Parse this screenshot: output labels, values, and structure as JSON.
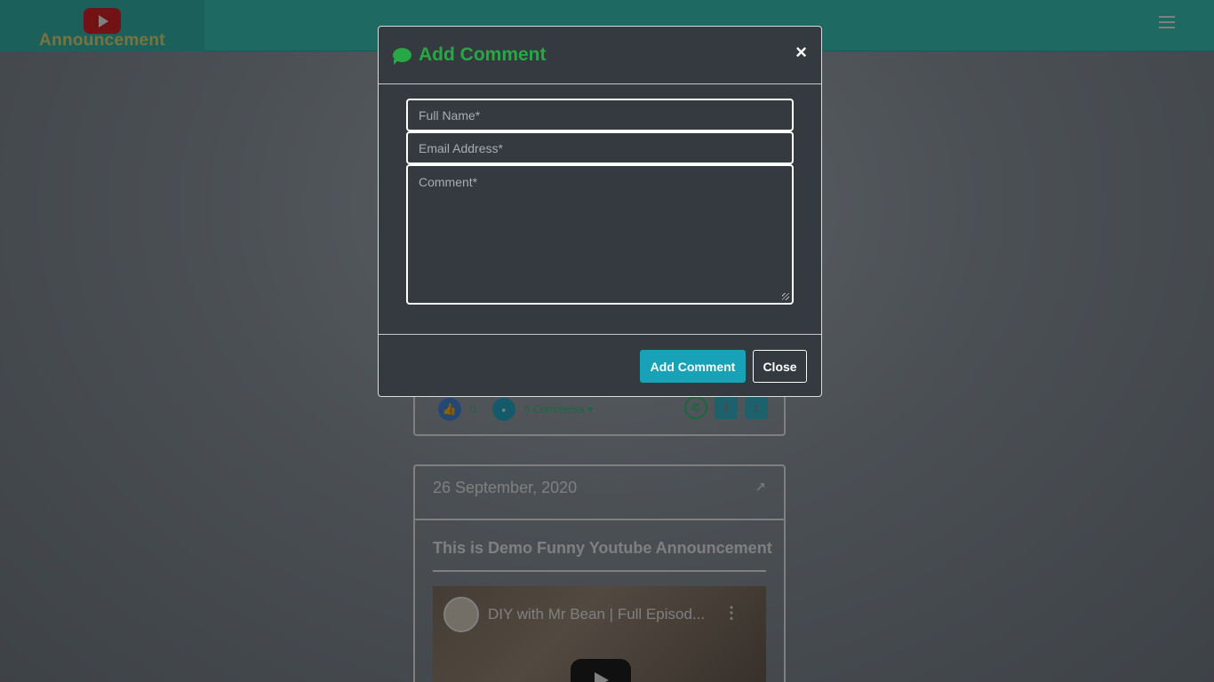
{
  "nav": {
    "brand_text": "Announcement",
    "menu_icon": "hamburger-icon"
  },
  "card1": {
    "like_count": "0",
    "comments_label": "0 Comments",
    "share_icons": [
      "whatsapp-icon",
      "facebook-icon",
      "twitter-icon"
    ]
  },
  "card2": {
    "date": "26 September, 2020",
    "title": "This is Demo Funny Youtube Announcement",
    "video_title": "DIY with Mr Bean | Full Episod..."
  },
  "modal": {
    "title": "Add Comment",
    "close_symbol": "×",
    "fullname_placeholder": "Full Name*",
    "email_placeholder": "Email Address*",
    "comment_placeholder": "Comment*",
    "add_button": "Add Comment",
    "close_button": "Close"
  },
  "colors": {
    "accent": "#3fd3c6",
    "title_green": "#28a745",
    "add_button": "#17a2b8",
    "modal_bg": "#343a40"
  }
}
